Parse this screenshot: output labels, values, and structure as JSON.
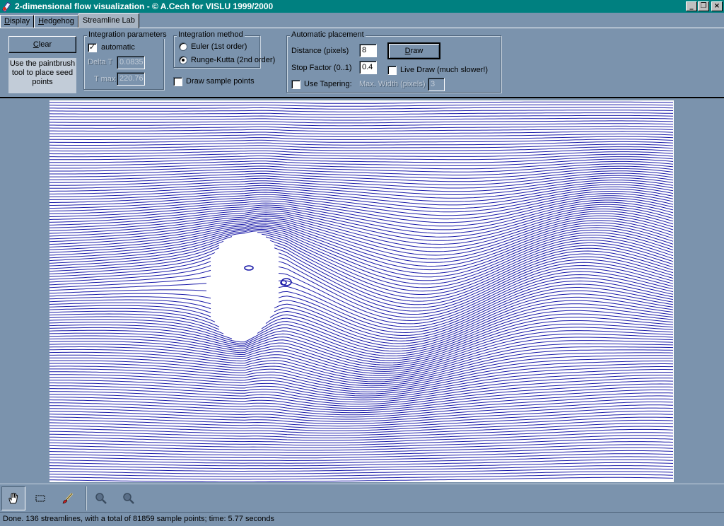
{
  "window": {
    "title": "2-dimensional flow visualization - © A.Cech for VISLU 1999/2000",
    "minimize_glyph": "_",
    "restore_glyph": "❐",
    "close_glyph": "×"
  },
  "tabs": [
    {
      "label": "Display",
      "accel": "D",
      "rest": "isplay"
    },
    {
      "label": "Hedgehog",
      "accel": "H",
      "rest": "edgehog"
    },
    {
      "label": "Streamline Lab",
      "accel": "",
      "rest": "Streamline Lab"
    }
  ],
  "panel": {
    "clear_button": {
      "accel": "C",
      "rest": "lear"
    },
    "hint": "Use the paintbrush tool to place seed points",
    "integration_parameters": {
      "legend": "Integration parameters",
      "automatic_label": "automatic",
      "automatic_checked": true,
      "delta_t_label": "Delta T",
      "delta_t_value": "0.0835",
      "t_max_label": "T max",
      "t_max_value": "220.76"
    },
    "integration_method": {
      "legend": "Integration method",
      "euler_label": "Euler (1st order)",
      "runge_kutta_label": "Runge-Kutta (2nd order)",
      "selected": "runge_kutta"
    },
    "draw_sample_points_label": "Draw sample points",
    "draw_sample_points_checked": false,
    "automatic_placement": {
      "legend": "Automatic placement",
      "distance_label": "Distance (pixels)",
      "distance_value": "8",
      "stop_factor_label": "Stop Factor (0..1)",
      "stop_factor_value": "0.4",
      "draw_button": {
        "accel": "D",
        "rest": "raw"
      },
      "live_draw_label": "Live Draw (much slower!)",
      "live_draw_checked": false,
      "use_tapering_label": "Use Tapering:",
      "use_tapering_checked": false,
      "max_width_label": "Max. Width (pixels)",
      "max_width_value": "3"
    }
  },
  "canvas": {
    "line_color": "#1a1aa8",
    "background": "#ffffff",
    "streamline_count": 136
  },
  "toolbar": {
    "tools": [
      {
        "name": "hand-tool",
        "icon": "hand-icon",
        "active": true
      },
      {
        "name": "select-tool",
        "icon": "rectangle-select-icon",
        "active": false
      },
      {
        "name": "paintbrush-tool",
        "icon": "paintbrush-icon",
        "active": false
      },
      {
        "name": "zoom-in-tool",
        "icon": "magnifier-icon",
        "active": false
      },
      {
        "name": "zoom-out-tool",
        "icon": "magnifier-icon",
        "active": false
      }
    ]
  },
  "status": {
    "text": "Done. 136 streamlines, with a total of 81859 sample points; time: 5.77 seconds"
  }
}
